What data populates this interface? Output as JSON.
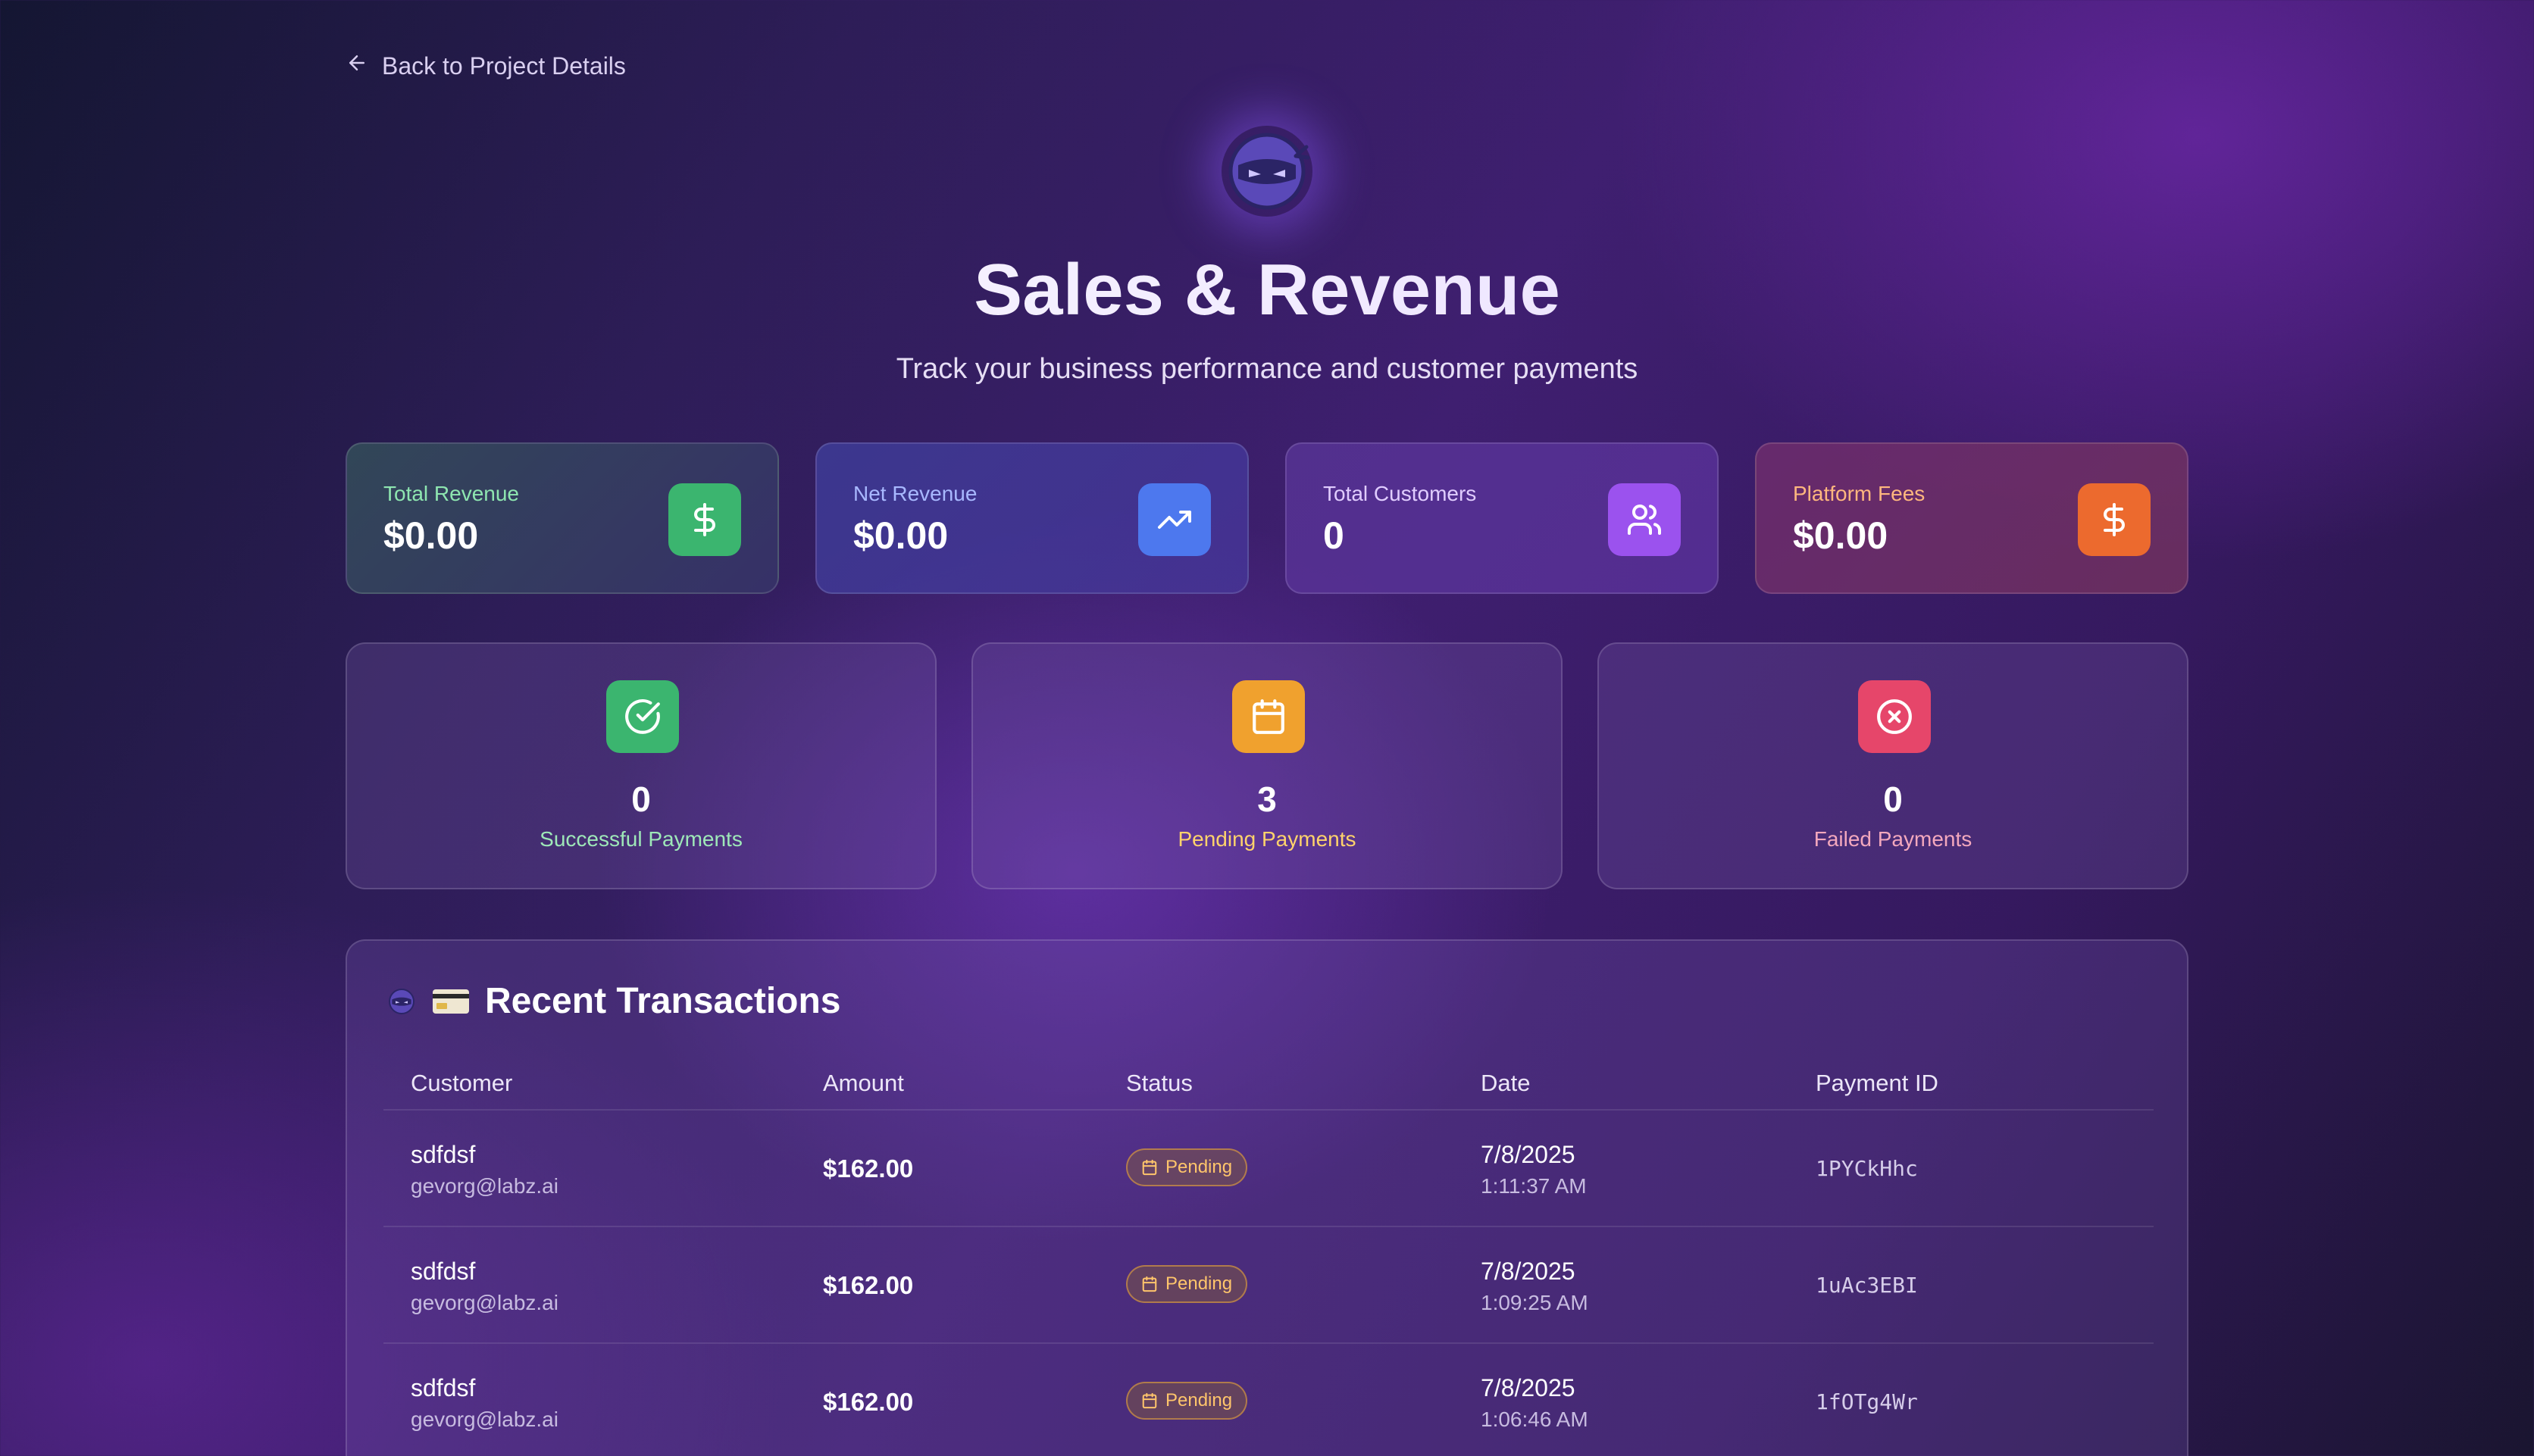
{
  "nav": {
    "back_label": "Back to Project Details"
  },
  "header": {
    "title": "Sales & Revenue",
    "subtitle": "Track your business performance and customer payments"
  },
  "stats": [
    {
      "label": "Total Revenue",
      "value": "$0.00",
      "icon": "dollar-icon",
      "accent": "#3bb56f"
    },
    {
      "label": "Net Revenue",
      "value": "$0.00",
      "icon": "trending-up-icon",
      "accent": "#4d78ee"
    },
    {
      "label": "Total Customers",
      "value": "0",
      "icon": "users-icon",
      "accent": "#9b52ee"
    },
    {
      "label": "Platform Fees",
      "value": "$0.00",
      "icon": "dollar-icon",
      "accent": "#ec6a2e"
    }
  ],
  "payments": [
    {
      "count": "0",
      "label": "Successful Payments",
      "icon": "check-circle-icon",
      "accent": "#3bb56f"
    },
    {
      "count": "3",
      "label": "Pending Payments",
      "icon": "calendar-icon",
      "accent": "#f0a12e"
    },
    {
      "count": "0",
      "label": "Failed Payments",
      "icon": "x-circle-icon",
      "accent": "#e6466a"
    }
  ],
  "transactions": {
    "title": "Recent Transactions",
    "columns": [
      "Customer",
      "Amount",
      "Status",
      "Date",
      "Payment ID"
    ],
    "rows": [
      {
        "customer": "sdfdsf",
        "email": "gevorg@labz.ai",
        "amount": "$162.00",
        "status": "Pending",
        "date": "7/8/2025",
        "time": "1:11:37 AM",
        "payment_id": "1PYCkHhc"
      },
      {
        "customer": "sdfdsf",
        "email": "gevorg@labz.ai",
        "amount": "$162.00",
        "status": "Pending",
        "date": "7/8/2025",
        "time": "1:09:25 AM",
        "payment_id": "1uAc3EBI"
      },
      {
        "customer": "sdfdsf",
        "email": "gevorg@labz.ai",
        "amount": "$162.00",
        "status": "Pending",
        "date": "7/8/2025",
        "time": "1:06:46 AM",
        "payment_id": "1fOTg4Wr"
      }
    ]
  }
}
